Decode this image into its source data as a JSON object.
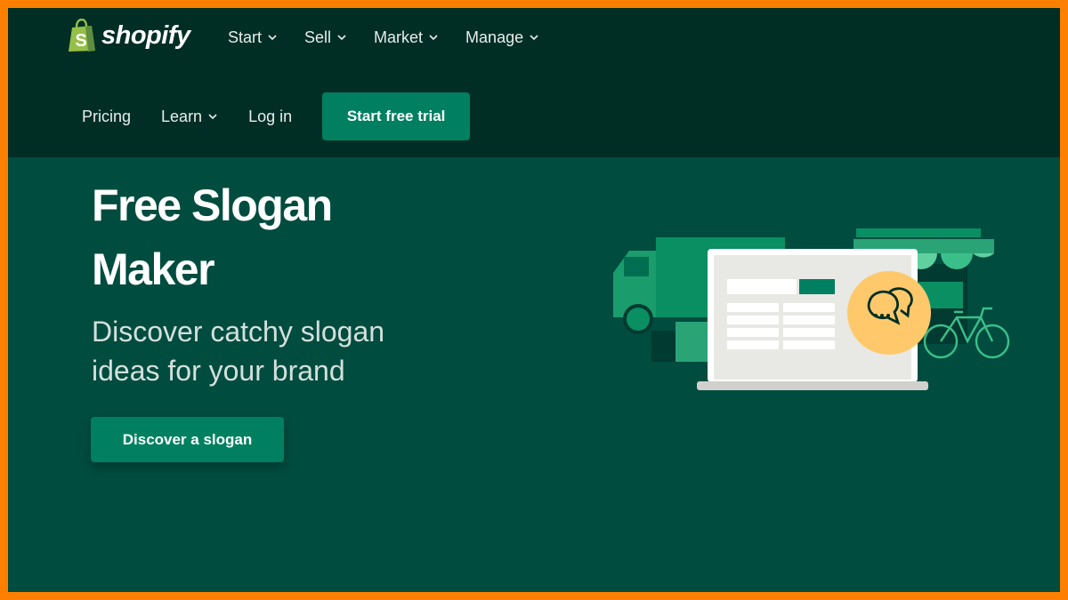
{
  "brand": {
    "name": "shopify",
    "icon": "shopping-bag-icon",
    "color": "#95bf47"
  },
  "nav": {
    "primary": [
      {
        "label": "Start",
        "has_dropdown": true
      },
      {
        "label": "Sell",
        "has_dropdown": true
      },
      {
        "label": "Market",
        "has_dropdown": true
      },
      {
        "label": "Manage",
        "has_dropdown": true
      }
    ],
    "secondary": [
      {
        "label": "Pricing",
        "has_dropdown": false
      },
      {
        "label": "Learn",
        "has_dropdown": true
      },
      {
        "label": "Log in",
        "has_dropdown": false
      }
    ],
    "cta_label": "Start free trial"
  },
  "hero": {
    "title_line1": "Free Slogan",
    "title_line2": "Maker",
    "subtitle_line1": "Discover catchy slogan",
    "subtitle_line2": "ideas for your brand",
    "button_label": "Discover a slogan"
  },
  "colors": {
    "frame": "#ff7f00",
    "header_bg": "#002e25",
    "hero_bg": "#004c3f",
    "accent": "#008060",
    "chat_bubble": "#ffc96b"
  }
}
